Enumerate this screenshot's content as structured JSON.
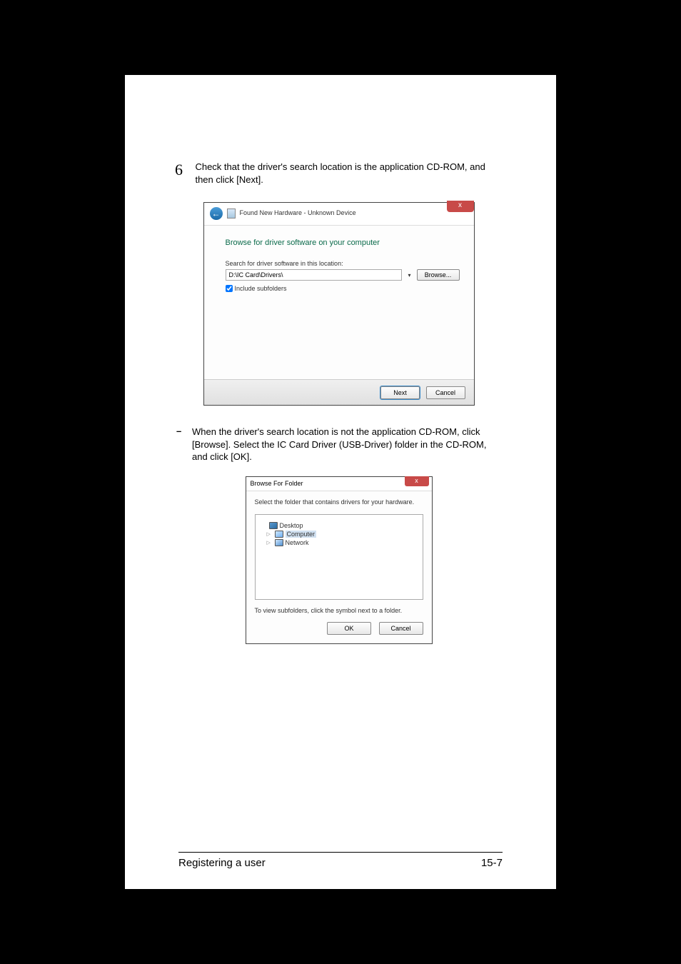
{
  "step": {
    "number": "6",
    "text": "Check that the driver's search location is the application CD-ROM, and then click [Next]."
  },
  "dialog1": {
    "title": "Found New Hardware - Unknown Device",
    "heading": "Browse for driver software on your computer",
    "search_label": "Search for driver software in this location:",
    "search_value": "D:\\IC Card\\Drivers\\",
    "browse_label": "Browse...",
    "include_label": "Include subfolders",
    "next_label": "Next",
    "cancel_label": "Cancel",
    "close_label": "x"
  },
  "sub": {
    "dash": "–",
    "text": "When the driver's search location is not the application CD-ROM, click [Browse]. Select the IC Card Driver (USB-Driver) folder in the CD-ROM, and click [OK]."
  },
  "dialog2": {
    "title": "Browse For Folder",
    "select_text": "Select the folder that contains drivers for your hardware.",
    "tree": {
      "desktop": "Desktop",
      "computer": "Computer",
      "network": "Network"
    },
    "subfolder_text": "To view subfolders, click the symbol next to a folder.",
    "ok_label": "OK",
    "cancel_label": "Cancel",
    "close_label": "x"
  },
  "footer": {
    "section": "Registering a user",
    "page": "15-7"
  }
}
